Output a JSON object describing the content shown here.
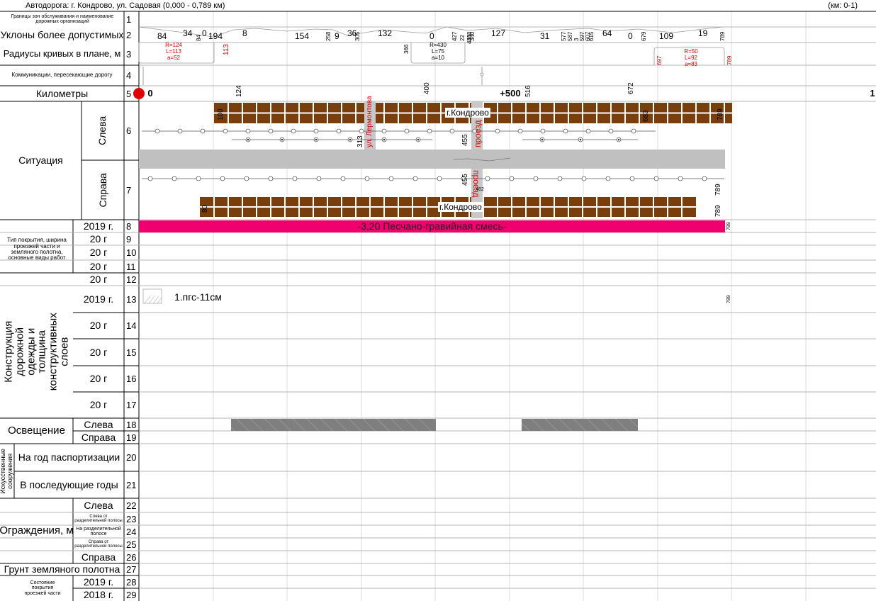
{
  "header": {
    "title": "Автодорога: г. Кондрово, ул. Садовая (0,000 - 0,789 км)",
    "km": "(км: 0-1)"
  },
  "labels": {
    "r1": "Границы зон обслуживания и наименование дорожных организаций",
    "r2": "Уклоны более допустимых",
    "r3": "Радиусы кривых в плане, м",
    "r4": "Коммуникации, пересекающие дорогу",
    "r5": "Километры",
    "situation": "Ситуация",
    "left": "Слева",
    "right": "Справа",
    "pavement_type": "Тип покрытия, ширина проезжей части и земляного полотна, основные виды работ",
    "construction": "Конструкция дорожной одежды и толщина конструктивных слоев",
    "lighting": "Освещение",
    "structures": "Искусственные сооружения",
    "passport_year": "На год паспортизации",
    "next_years": "В последующие годы",
    "barriers": "Ограждения, м",
    "left_of_divider": "Слева от разделительной полосы",
    "on_divider": "На разделительной полосе",
    "right_of_divider": "Справа от разделительной полосы",
    "subgrade": "Грунт земляного полотна",
    "condition": "Состояние покрытия проезжей части",
    "y2019": "2019 г.",
    "y2018": "2018 г.",
    "y20": "20 г"
  },
  "row_numbers": [
    "1",
    "2",
    "3",
    "4",
    "5",
    "6",
    "7",
    "8",
    "9",
    "10",
    "11",
    "12",
    "13",
    "14",
    "15",
    "16",
    "17",
    "18",
    "19",
    "20",
    "21",
    "22",
    "23",
    "24",
    "25",
    "26",
    "27",
    "28",
    "29"
  ],
  "slopes": [
    "84",
    "34",
    "84",
    "0",
    "194",
    "8",
    "154",
    "258",
    "9",
    "36",
    "305",
    "132",
    "0",
    "427",
    "22",
    "388",
    "340",
    "127",
    "31",
    "577",
    "587",
    "3",
    "597",
    "607",
    "615",
    "64",
    "0",
    "679",
    "109",
    "19",
    "789"
  ],
  "curves": [
    {
      "r": "R=124",
      "l": "L=113",
      "a": "a=52",
      "end": "113"
    },
    {
      "r": "R=430",
      "l": "L=75",
      "a": "a=10",
      "start": "366",
      "end": "441"
    },
    {
      "r": "R=50",
      "l": "L=92",
      "a": "a=83",
      "start": "697",
      "end": "789"
    }
  ],
  "km": {
    "zero": "0",
    "plus500": "+500",
    "one": "1",
    "ticks": [
      "124",
      "400",
      "516",
      "672"
    ]
  },
  "situation": {
    "town": "г.Кондрово",
    "street": "ул. Лермонтова",
    "lane": "проезд",
    "marks_left": [
      "100",
      "313",
      "455",
      "683",
      "789"
    ],
    "marks_right": [
      "80",
      "455",
      "462",
      "789",
      "789"
    ]
  },
  "pavement": {
    "label": "-3,20 Песчано-гравийная смесь-",
    "end": "789",
    "color": "#f0006e"
  },
  "construction": {
    "layer": "1.пгс-11см",
    "end": "789"
  },
  "colors": {
    "building": "#7a3d0c",
    "road": "#c0c0c0",
    "lighting": "#808080"
  }
}
